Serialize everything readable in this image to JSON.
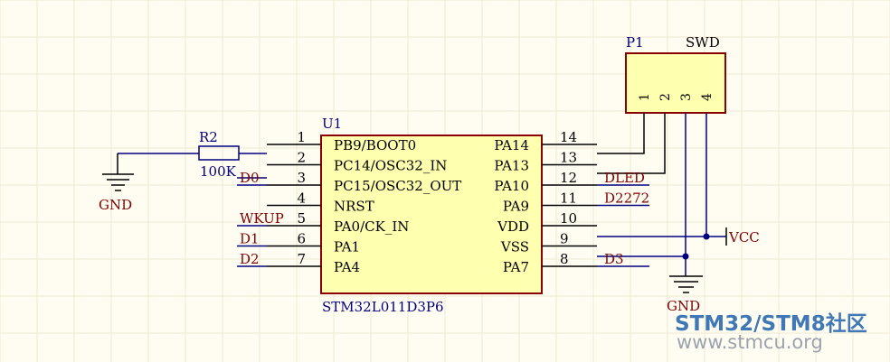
{
  "colors": {
    "background": "#fffdf2",
    "grid": "#efe9d2",
    "wire": "#00007f",
    "line": "#000000",
    "chip_fill": "#ffffb0",
    "chip_border": "#8b0000",
    "net_label": "#800000",
    "designator": "#00007f",
    "pin_text": "#000000",
    "watermark_blue": "#3f78b4",
    "watermark_gray": "#9aa3ad"
  },
  "u1": {
    "designator": "U1",
    "part": "STM32L011D3P6",
    "left_pins": [
      {
        "num": "1",
        "name": "PB9/BOOT0"
      },
      {
        "num": "2",
        "name": "PC14/OSC32_IN"
      },
      {
        "num": "3",
        "name": "PC15/OSC32_OUT"
      },
      {
        "num": "4",
        "name": "NRST"
      },
      {
        "num": "5",
        "name": "PA0/CK_IN"
      },
      {
        "num": "6",
        "name": "PA1"
      },
      {
        "num": "7",
        "name": "PA4"
      }
    ],
    "right_pins": [
      {
        "num": "14",
        "name": "PA14"
      },
      {
        "num": "13",
        "name": "PA13"
      },
      {
        "num": "12",
        "name": "PA10"
      },
      {
        "num": "11",
        "name": "PA9"
      },
      {
        "num": "10",
        "name": "VDD"
      },
      {
        "num": "9",
        "name": "VSS"
      },
      {
        "num": "8",
        "name": "PA7"
      }
    ]
  },
  "nets_left": [
    "",
    "",
    "D0",
    "",
    "WKUP",
    "D1",
    "D2"
  ],
  "nets_right": [
    "",
    "",
    "DLED",
    "D2272",
    "",
    "",
    "D3"
  ],
  "r2": {
    "designator": "R2",
    "value": "100K"
  },
  "p1": {
    "designator": "P1",
    "label": "SWD",
    "pins": [
      "1",
      "2",
      "3",
      "4"
    ]
  },
  "power": {
    "gnd_left": "GND",
    "gnd_right": "GND",
    "vcc": "VCC"
  },
  "watermark": {
    "brand": "STM32/STM8社区",
    "url": "www.stmcu.org"
  }
}
